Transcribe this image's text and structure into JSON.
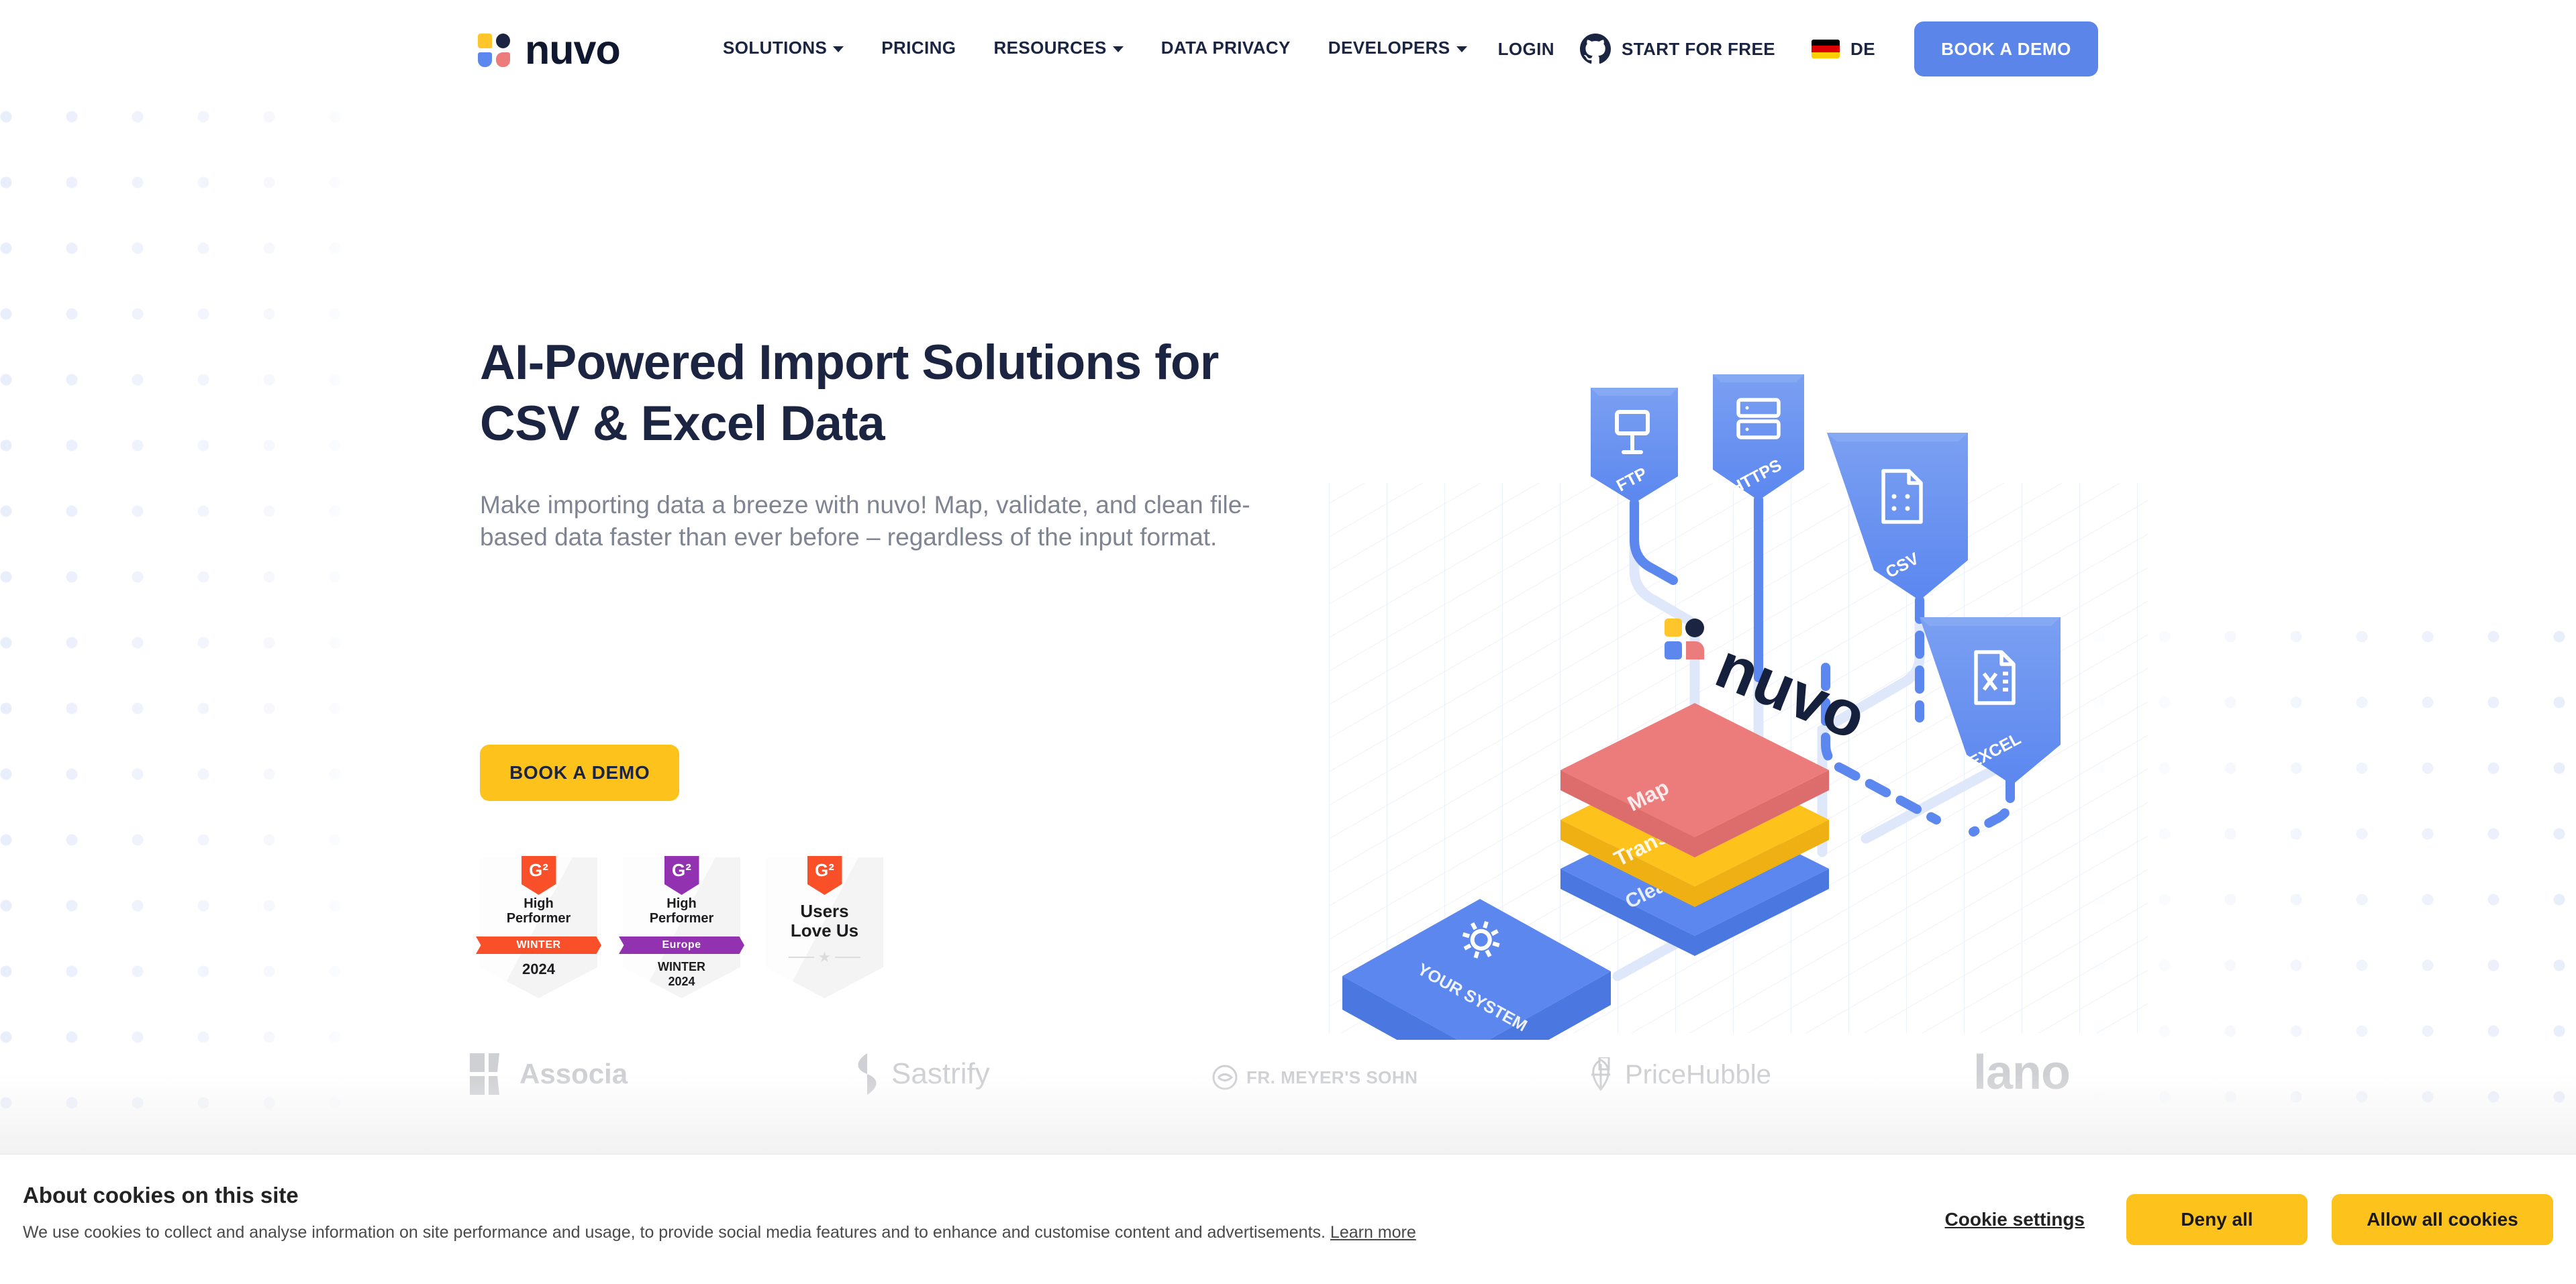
{
  "brand": {
    "name": "nuvo",
    "logo_colors": {
      "yellow": "#ffc62b",
      "navy": "#1b2542",
      "blue": "#5b87ef",
      "red": "#ec7b7b"
    },
    "accent_blue": "#5b85e8",
    "accent_yellow": "#fdc21c",
    "text_dark": "#1b2542",
    "text_muted": "#7e8492"
  },
  "header": {
    "nav": [
      {
        "label": "SOLUTIONS",
        "has_dropdown": true
      },
      {
        "label": "PRICING",
        "has_dropdown": false
      },
      {
        "label": "RESOURCES",
        "has_dropdown": true
      },
      {
        "label": "DATA PRIVACY",
        "has_dropdown": false
      },
      {
        "label": "DEVELOPERS",
        "has_dropdown": true
      }
    ],
    "login_label": "LOGIN",
    "github_icon": "github-icon",
    "start_free_label": "START FOR FREE",
    "language_label": "DE",
    "language_flag": "german-flag-icon",
    "cta_label": "BOOK A DEMO"
  },
  "hero": {
    "title_line1": "AI-Powered Import Solutions for",
    "title_line2": "CSV & Excel Data",
    "subtitle": "Make importing data a breeze with nuvo! Map, validate, and clean file-based data faster than ever before – regardless of the input format.",
    "cta_label": "BOOK A DEMO"
  },
  "badges": [
    {
      "name": "g2-high-performer-winter-2024",
      "title_line1": "High",
      "title_line2": "Performer",
      "ribbon": "WINTER",
      "ribbon_color": "#f9502a",
      "notch_color": "#f9502a",
      "foot": "2024",
      "foot2": "",
      "has_stars": false
    },
    {
      "name": "g2-high-performer-europe-winter-2024",
      "title_line1": "High",
      "title_line2": "Performer",
      "ribbon": "Europe",
      "ribbon_color": "#9332b0",
      "notch_color": "#9332b0",
      "foot": "WINTER",
      "foot2": "2024",
      "has_stars": false
    },
    {
      "name": "g2-users-love-us",
      "title_line1": "Users",
      "title_line2": "Love Us",
      "ribbon": "",
      "ribbon_color": "",
      "notch_color": "#f9502a",
      "foot": "",
      "foot2": "",
      "has_stars": true
    }
  ],
  "illustration": {
    "name": "nuvo-data-pipeline-isometric-diagram",
    "sources": [
      {
        "label": "FTP",
        "icon": "ftp-server-icon"
      },
      {
        "label": "HTTPS",
        "icon": "https-server-icon"
      },
      {
        "label": "CSV",
        "icon": "csv-file-icon"
      },
      {
        "label": "EXCEL",
        "icon": "excel-file-icon"
      }
    ],
    "layers": [
      {
        "label": "Map",
        "color": "#ec7b7b"
      },
      {
        "label": "Transform",
        "color": "#fdc21c"
      },
      {
        "label": "Clean",
        "color": "#5b87ef"
      }
    ],
    "destination": {
      "label": "YOUR SYSTEM",
      "icon": "gear-icon"
    },
    "center_logo": "nuvo"
  },
  "customer_logos": [
    {
      "name": "associa-logo",
      "label": "Associa"
    },
    {
      "name": "sastrify-logo",
      "label": "Sastrify"
    },
    {
      "name": "fr-meyers-sohn-logo",
      "label": "FR. MEYER'S SOHN"
    },
    {
      "name": "pricehubble-logo",
      "label": "PriceHubble"
    },
    {
      "name": "lano-logo",
      "label": "lano"
    }
  ],
  "cookie_banner": {
    "title": "About cookies on this site",
    "body": "We use cookies to collect and analyse information on site performance and usage, to provide social media features and to enhance and customise content and advertisements.",
    "learn_more": "Learn more",
    "settings_label": "Cookie settings",
    "deny_label": "Deny all",
    "allow_label": "Allow all cookies"
  }
}
